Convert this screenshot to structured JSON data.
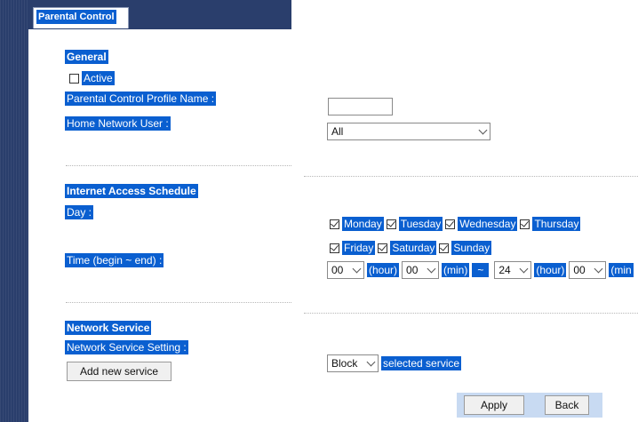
{
  "tab": {
    "label": "Parental Control"
  },
  "general": {
    "heading": "General",
    "active_label": "Active",
    "profile_name_label": "Parental Control Profile Name :",
    "profile_name_value": "",
    "home_user_label": "Home Network User :",
    "home_user_value": "All"
  },
  "schedule": {
    "heading": "Internet Access Schedule",
    "day_label": "Day :",
    "time_label": "Time (begin ~ end) :",
    "days": [
      {
        "name": "Monday",
        "checked": true
      },
      {
        "name": "Tuesday",
        "checked": true
      },
      {
        "name": "Wednesday",
        "checked": true
      },
      {
        "name": "Thursday",
        "checked": true
      },
      {
        "name": "Friday",
        "checked": true
      },
      {
        "name": "Saturday",
        "checked": true
      },
      {
        "name": "Sunday",
        "checked": true
      }
    ],
    "begin_hour": "00",
    "begin_min": "00",
    "end_hour": "24",
    "end_min": "00",
    "hour_unit": "(hour)",
    "min_unit": "(min)",
    "min_unit_cut": "(min",
    "separator": "~"
  },
  "service": {
    "heading": "Network Service",
    "setting_label": "Network Service Setting :",
    "add_button": "Add new service",
    "mode_value": "Block",
    "mode_suffix": "selected service"
  },
  "footer": {
    "apply": "Apply",
    "back": "Back"
  },
  "colors": {
    "sidebar": "#2a3e6c",
    "highlight": "#0a5fd0"
  }
}
